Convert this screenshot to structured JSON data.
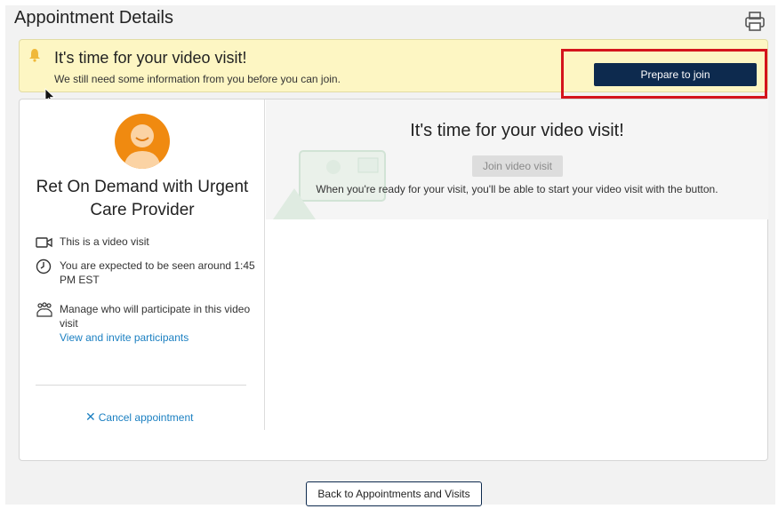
{
  "header": {
    "title": "Appointment Details",
    "print_icon": "print-icon"
  },
  "banner": {
    "icon": "bell-icon",
    "title": "It's time for your video visit!",
    "subtitle": "We still need some information from you before you can join.",
    "prepare_button": "Prepare to join",
    "highlight_color": "#d4141c",
    "background_color": "#fdf6c3"
  },
  "provider": {
    "avatar": "avatar-icon",
    "name": "Ret On Demand with Urgent Care Provider"
  },
  "details": {
    "video_visit_text": "This is a video visit",
    "expected_time_text": "You are expected to be seen around 1:45 PM EST",
    "participants_text": "Manage who will participate in this video visit",
    "participants_link": "View and invite participants"
  },
  "actions": {
    "cancel_label": "Cancel appointment",
    "back_label": "Back to Appointments and Visits"
  },
  "video_panel": {
    "title": "It's time for your video visit!",
    "join_button": "Join video visit",
    "description": "When you're ready for your visit, you'll be able to start your video visit with the button."
  },
  "colors": {
    "primary_button": "#0d2a4e",
    "link": "#1a7fc1",
    "avatar": "#f08a10"
  }
}
